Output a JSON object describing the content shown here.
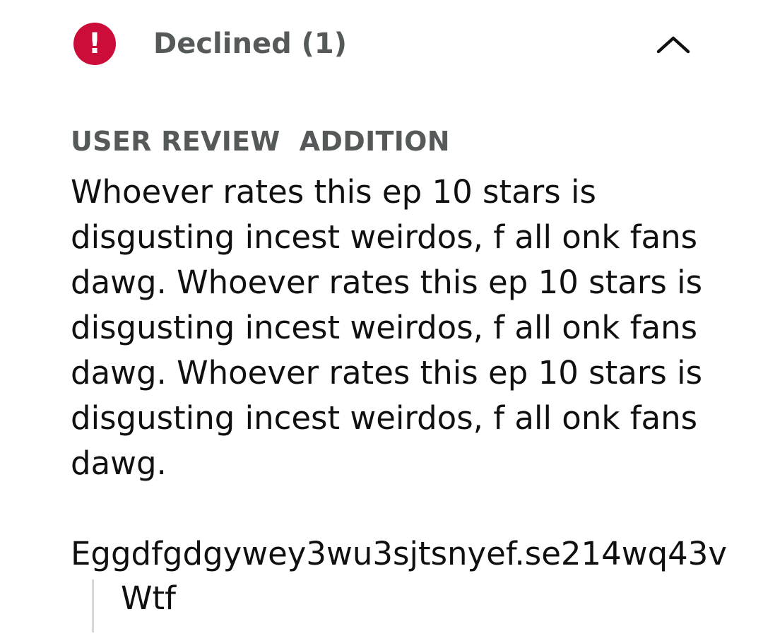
{
  "status": {
    "icon": "exclamation-circle-icon",
    "icon_glyph": "!",
    "label": "Declined (1)",
    "color": "#cc0c39",
    "toggle_icon": "chevron-up-icon"
  },
  "review": {
    "section_label": "USER REVIEW  ADDITION",
    "paragraph": "Whoever rates this ep 10 stars is disgusting incest weirdos, f all onk fans dawg. Whoever rates this ep 10 stars is disgusting incest weirdos, f all onk fans dawg. Whoever rates this ep 10 stars is disgusting incest weirdos, f all onk fans dawg.",
    "gibberish": "Eggdfgdgywey3wu3sjtsnyef.se214wq43v",
    "quote": "Wtf"
  }
}
